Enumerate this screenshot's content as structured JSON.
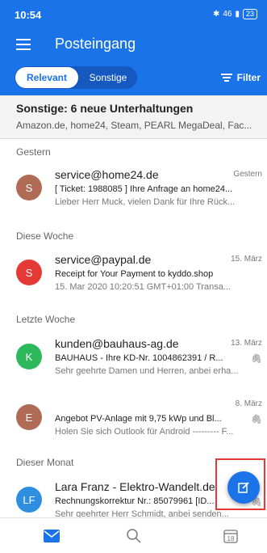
{
  "status_bar": {
    "time": "10:54",
    "network": "46",
    "battery": "23"
  },
  "app_bar": {
    "title": "Posteingang"
  },
  "filter_bar": {
    "tab_relevant": "Relevant",
    "tab_other": "Sonstige",
    "filter_label": "Filter"
  },
  "other_banner": {
    "title": "Sonstige: 6 neue Unterhaltungen",
    "senders": "Amazon.de, home24, Steam, PEARL MegaDeal, Fac..."
  },
  "sections": {
    "yesterday": "Gestern",
    "this_week": "Diese Woche",
    "last_week": "Letzte Woche",
    "this_month": "Dieser Monat"
  },
  "messages": [
    {
      "initial": "S",
      "color": "#b06b57",
      "sender": "service@home24.de",
      "date": "Gestern",
      "subject": "[ Ticket: 1988085 ] Ihre Anfrage an home24...",
      "preview": "Lieber Herr Muck, vielen Dank für Ihre Rück..."
    },
    {
      "initial": "S",
      "color": "#e53935",
      "sender": "service@paypal.de",
      "date": "15. März",
      "subject": "Receipt for Your Payment to kyddo.shop",
      "preview": "15. Mar 2020 10:20:51 GMT+01:00 Transa..."
    },
    {
      "initial": "K",
      "color": "#2eb85c",
      "sender": "kunden@bauhaus-ag.de",
      "date": "13. März",
      "subject": "BAUHAUS - Ihre KD-Nr. 1004862391 / R...",
      "preview": "Sehr geehrte Damen und Herren, anbei erha..."
    },
    {
      "initial": "E",
      "color": "#b06b57",
      "sender": "",
      "date": "8. März",
      "subject": "Angebot PV-Anlage mit 9,75 kWp und Bl...",
      "preview": "Holen Sie sich Outlook für Android --------- F..."
    },
    {
      "initial": "LF",
      "color": "#2e8fe0",
      "sender": "Lara Franz - Elektro-Wandelt.de",
      "date": "",
      "subject": "Rechnungskorrektur Nr.: 85079961 [ID...",
      "preview": "Sehr geehrter Herr Schmidt, anbei senden..."
    }
  ],
  "icons": {
    "menu": "hamburger-icon",
    "filter": "filter-icon",
    "attachment": "paperclip-icon",
    "compose": "compose-icon",
    "mail": "mail-icon",
    "search": "search-icon",
    "calendar": "calendar-icon"
  },
  "calendar_day": "18",
  "colors": {
    "accent": "#1a73e8",
    "highlight": "#e53935"
  }
}
